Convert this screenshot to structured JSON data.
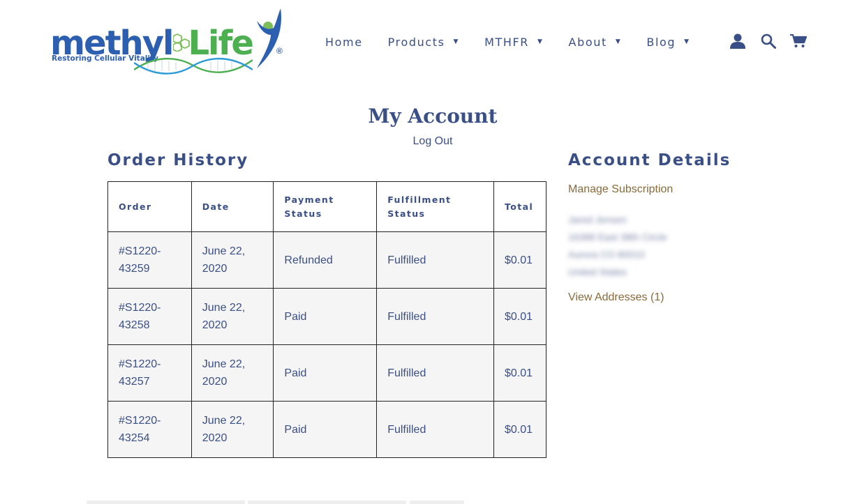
{
  "brand": {
    "name_part1": "methyl",
    "name_part2": "Life",
    "registered": "®",
    "tagline": "Restoring Cellular Vitality",
    "colors": {
      "blue": "#2c5fb0",
      "green": "#4caf50",
      "text": "#3a4f86",
      "link": "#8a6a3a"
    }
  },
  "nav": {
    "items": [
      {
        "label": "Home",
        "has_dropdown": false
      },
      {
        "label": "Products",
        "has_dropdown": true
      },
      {
        "label": "MTHFR",
        "has_dropdown": true
      },
      {
        "label": "About",
        "has_dropdown": true
      },
      {
        "label": "Blog",
        "has_dropdown": true
      }
    ],
    "caret": "▼",
    "icons": [
      "user-icon",
      "search-icon",
      "cart-icon"
    ]
  },
  "page": {
    "title": "My Account",
    "logout": "Log Out"
  },
  "order_history": {
    "title": "Order History",
    "columns": [
      "Order",
      "Date",
      "Payment Status",
      "Fulfillment Status",
      "Total"
    ],
    "rows": [
      {
        "order_a": "#S1220-",
        "order_b": "43259",
        "date_a": "June 22,",
        "date_b": "2020",
        "payment": "Refunded",
        "fulfillment": "Fulfilled",
        "total": "$0.01"
      },
      {
        "order_a": "#S1220-",
        "order_b": "43258",
        "date_a": "June 22,",
        "date_b": "2020",
        "payment": "Paid",
        "fulfillment": "Fulfilled",
        "total": "$0.01"
      },
      {
        "order_a": "#S1220-",
        "order_b": "43257",
        "date_a": "June 22,",
        "date_b": "2020",
        "payment": "Paid",
        "fulfillment": "Fulfilled",
        "total": "$0.01"
      },
      {
        "order_a": "#S1220-",
        "order_b": "43254",
        "date_a": "June 22,",
        "date_b": "2020",
        "payment": "Paid",
        "fulfillment": "Fulfilled",
        "total": "$0.01"
      }
    ]
  },
  "account_details": {
    "title": "Account Details",
    "manage_subscription": "Manage Subscription",
    "address_lines": [
      "Jared Jensen",
      "16388 East 38th Circle",
      "Aurora CO 80010",
      "United States"
    ],
    "view_addresses": "View Addresses (1)"
  }
}
